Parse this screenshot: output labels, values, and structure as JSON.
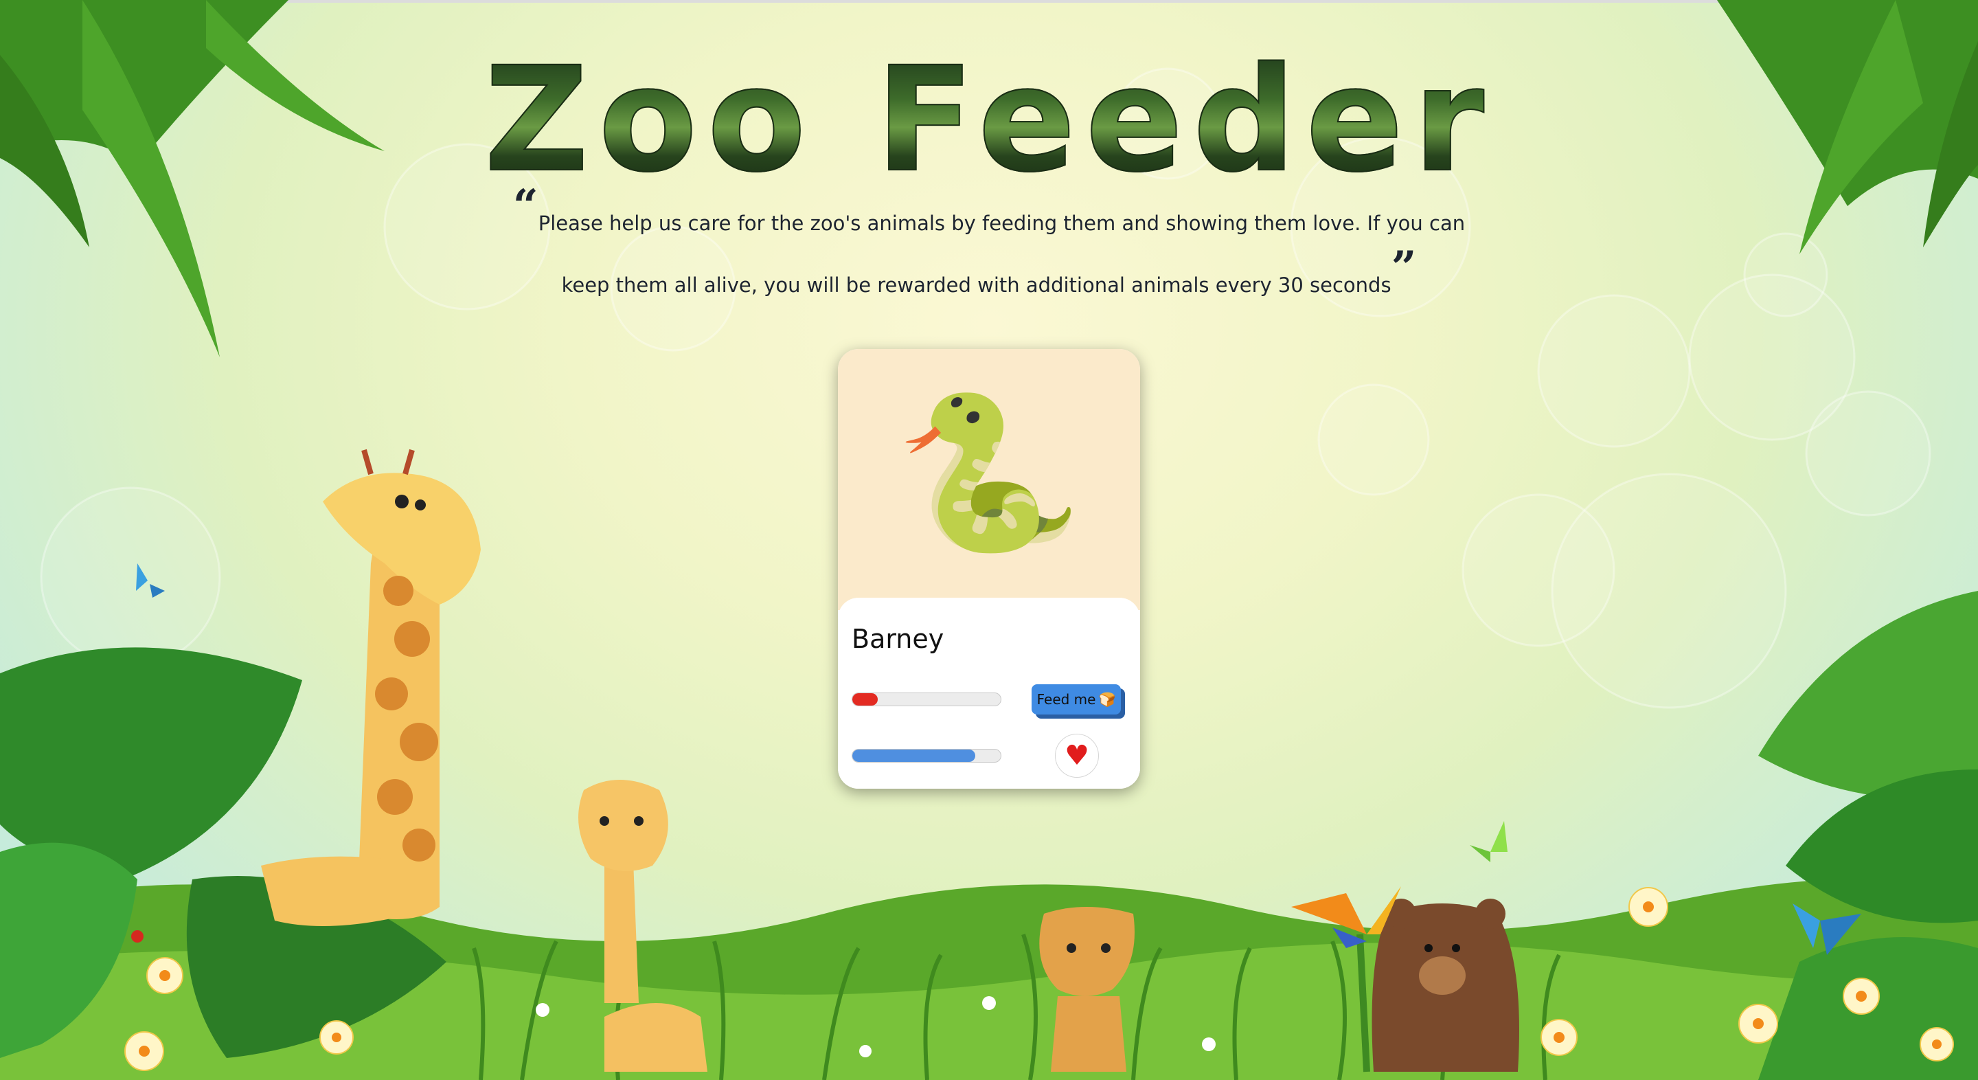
{
  "app": {
    "title": "Zoo Feeder",
    "description": "Please help us care for the zoo's animals by feeding them and showing them love. If you can keep them all alive, you will be rewarded with additional animals every 30 seconds",
    "open_quote_icon": "quote-open-icon",
    "close_quote_icon": "quote-close-icon"
  },
  "animals": [
    {
      "name": "Barney",
      "emoji": "🐍",
      "card_color": "#fbeacb",
      "hunger": 0.17,
      "hunger_color": "#e32b22",
      "love": 0.83,
      "love_color": "#4f8fe0",
      "feed_label": "Feed me",
      "feed_icon": "🍞",
      "love_icon": "♥"
    }
  ],
  "scene": {
    "theme": "jungle",
    "decorations": [
      "giraffe-adult",
      "giraffe-baby",
      "cheetah",
      "bear",
      "butterflies",
      "ladybug",
      "palm-leaves",
      "flowers",
      "grass"
    ]
  }
}
